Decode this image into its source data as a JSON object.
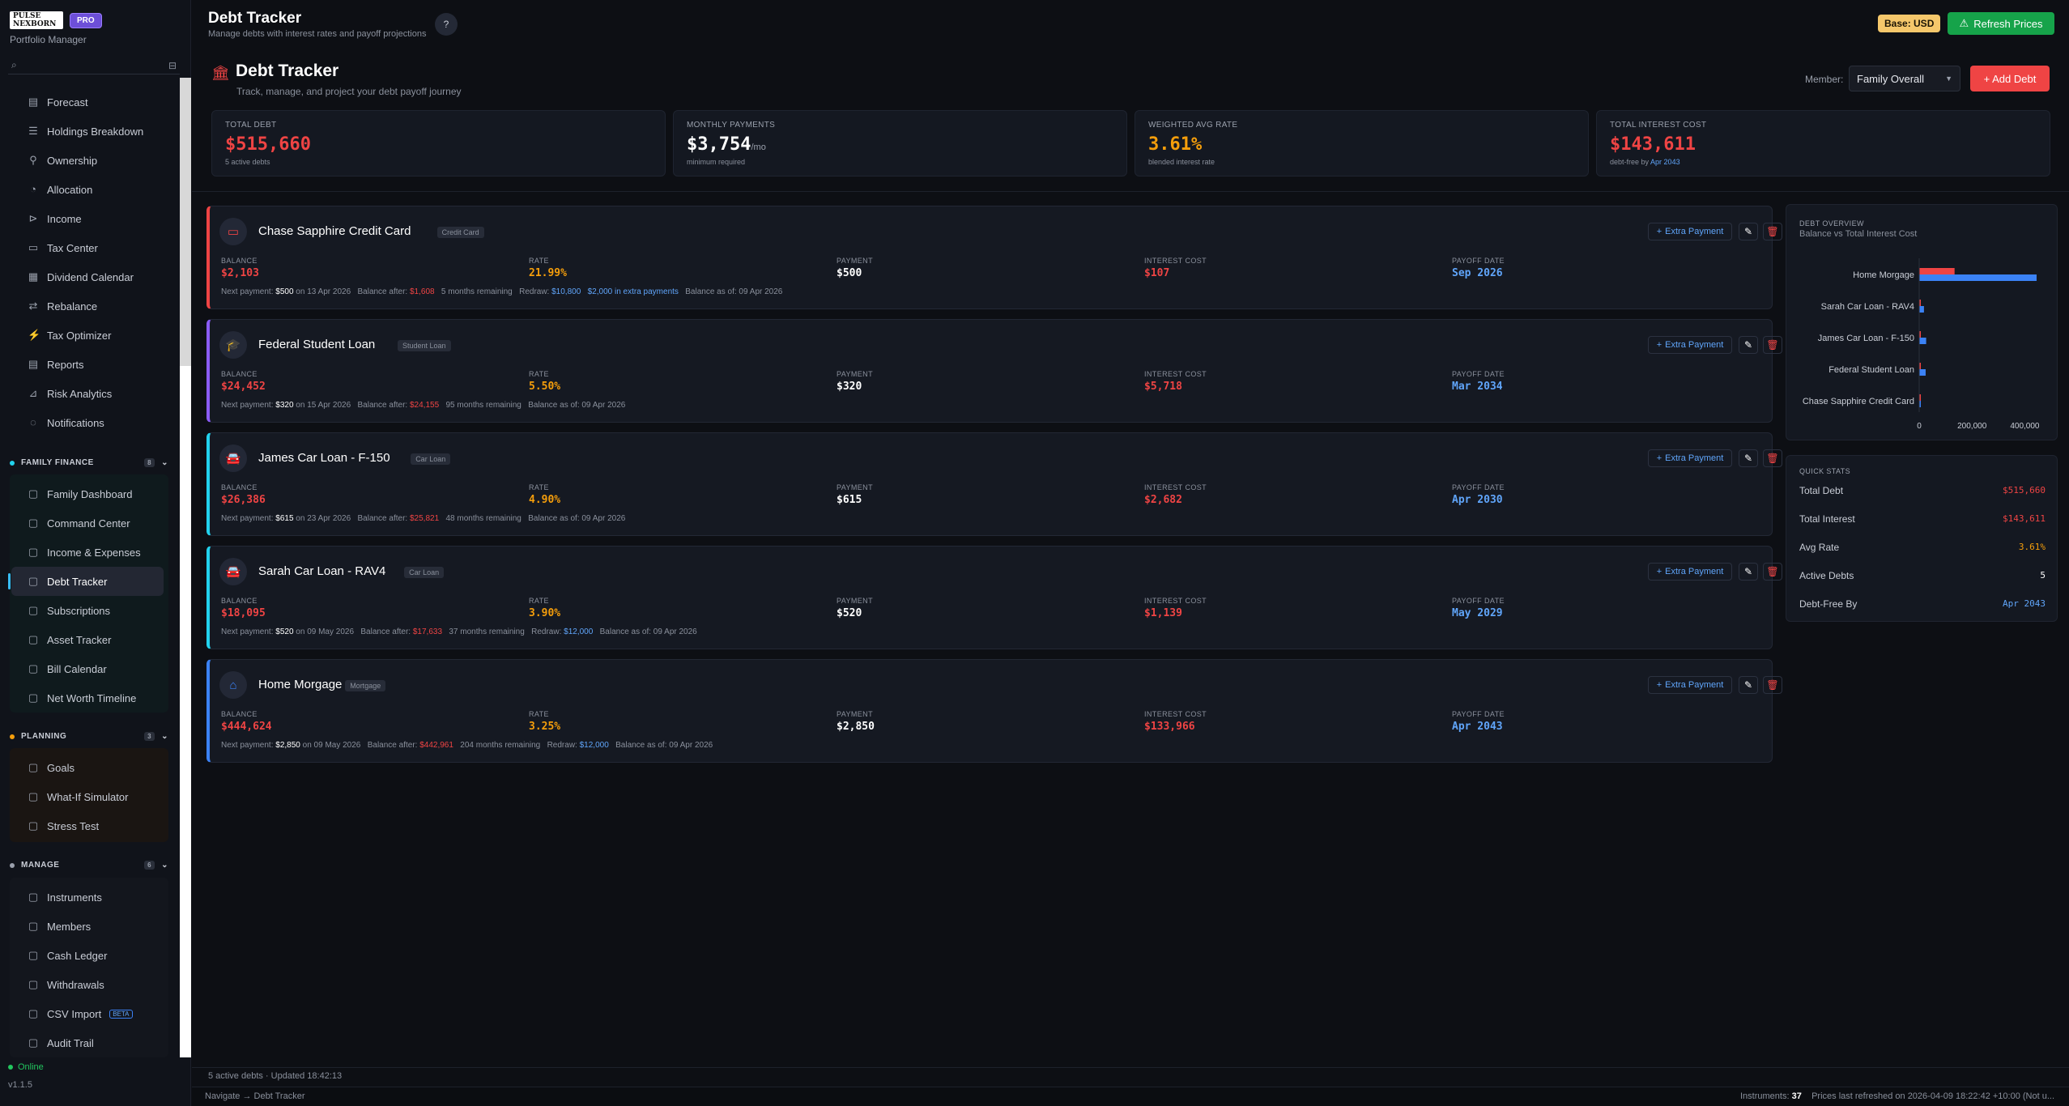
{
  "brand": {
    "logo_text": "PULSE NEXBORN",
    "pro": "PRO",
    "subtitle": "Portfolio Manager"
  },
  "sidebar": {
    "analysis_items": [
      {
        "label": "Forecast",
        "icon": "forecast-icon"
      },
      {
        "label": "Holdings Breakdown",
        "icon": "list-icon"
      },
      {
        "label": "Ownership",
        "icon": "ownership-icon"
      },
      {
        "label": "Allocation",
        "icon": "allocation-icon"
      },
      {
        "label": "Income",
        "icon": "income-icon"
      },
      {
        "label": "Tax Center",
        "icon": "tax-icon"
      },
      {
        "label": "Dividend Calendar",
        "icon": "calendar-icon"
      },
      {
        "label": "Rebalance",
        "icon": "rebalance-icon"
      },
      {
        "label": "Tax Optimizer",
        "icon": "optimizer-icon"
      },
      {
        "label": "Reports",
        "icon": "reports-icon"
      },
      {
        "label": "Risk Analytics",
        "icon": "risk-icon"
      },
      {
        "label": "Notifications",
        "icon": "bell-icon"
      }
    ],
    "family": {
      "title": "FAMILY FINANCE",
      "count": "8",
      "items": [
        {
          "label": "Family Dashboard"
        },
        {
          "label": "Command Center"
        },
        {
          "label": "Income & Expenses"
        },
        {
          "label": "Debt Tracker"
        },
        {
          "label": "Subscriptions"
        },
        {
          "label": "Asset Tracker"
        },
        {
          "label": "Bill Calendar"
        },
        {
          "label": "Net Worth Timeline"
        }
      ]
    },
    "planning": {
      "title": "PLANNING",
      "count": "3",
      "items": [
        {
          "label": "Goals"
        },
        {
          "label": "What-If Simulator"
        },
        {
          "label": "Stress Test"
        }
      ]
    },
    "manage": {
      "title": "MANAGE",
      "count": "6",
      "items": [
        {
          "label": "Instruments"
        },
        {
          "label": "Members"
        },
        {
          "label": "Cash Ledger"
        },
        {
          "label": "Withdrawals"
        },
        {
          "label": "CSV Import",
          "badge": "BETA"
        },
        {
          "label": "Audit Trail"
        }
      ]
    },
    "status": "Online",
    "version": "v1.1.5"
  },
  "topbar": {
    "title": "Debt Tracker",
    "subtitle": "Manage debts with interest rates and payoff projections",
    "help": "?",
    "base": "Base: USD",
    "refresh": "Refresh Prices"
  },
  "page": {
    "title": "Debt Tracker",
    "subtitle": "Track, manage, and project your debt payoff journey",
    "member_label": "Member:",
    "member_value": "Family Overall",
    "add_debt": "+ Add Debt"
  },
  "stats": [
    {
      "label": "TOTAL DEBT",
      "value": "$515,660",
      "unit": "",
      "note": "5 active debts",
      "note_link": "",
      "color": "#ef4444"
    },
    {
      "label": "MONTHLY PAYMENTS",
      "value": "$3,754",
      "unit": "/mo",
      "note": "minimum required",
      "note_link": "",
      "color": "#ffffff"
    },
    {
      "label": "WEIGHTED AVG RATE",
      "value": "3.61%",
      "unit": "",
      "note": "blended interest rate",
      "note_link": "",
      "color": "#f59e0b"
    },
    {
      "label": "TOTAL INTEREST COST",
      "value": "$143,611",
      "unit": "",
      "note": "debt-free by",
      "note_link": "Apr 2043",
      "color": "#ef4444"
    }
  ],
  "labels": {
    "balance": "BALANCE",
    "rate": "RATE",
    "payment": "PAYMENT",
    "interest": "INTEREST COST",
    "payoff": "PAYOFF DATE",
    "extra": "Extra Payment",
    "next_payment": "Next payment:",
    "on": "on",
    "balance_after": "Balance after:",
    "redraw": "Redraw:",
    "balance_as_of": "Balance as of:"
  },
  "debts": [
    {
      "name": "Chase Sapphire Credit Card",
      "type": "Credit Card",
      "balance": "$2,103",
      "rate": "21.99%",
      "payment": "$500",
      "interest": "$107",
      "payoff": "Sep 2026",
      "next_amount": "$500",
      "next_date": "13 Apr 2026",
      "bal_after": "$1,608",
      "remaining": "5 months remaining",
      "redraw": "$10,800",
      "extra_note": "$2,000 in extra payments",
      "as_of": "09 Apr 2026",
      "color": "#ef4444",
      "icon": "credit-card-icon"
    },
    {
      "name": "Federal Student Loan",
      "type": "Student Loan",
      "balance": "$24,452",
      "rate": "5.50%",
      "payment": "$320",
      "interest": "$5,718",
      "payoff": "Mar 2034",
      "next_amount": "$320",
      "next_date": "15 Apr 2026",
      "bal_after": "$24,155",
      "remaining": "95 months remaining",
      "redraw": "",
      "extra_note": "",
      "as_of": "09 Apr 2026",
      "color": "#8b5cf6",
      "icon": "graduation-cap-icon"
    },
    {
      "name": "James Car Loan - F-150",
      "type": "Car Loan",
      "balance": "$26,386",
      "rate": "4.90%",
      "payment": "$615",
      "interest": "$2,682",
      "payoff": "Apr 2030",
      "next_amount": "$615",
      "next_date": "23 Apr 2026",
      "bal_after": "$25,821",
      "remaining": "48 months remaining",
      "redraw": "",
      "extra_note": "",
      "as_of": "09 Apr 2026",
      "color": "#22d3ee",
      "icon": "car-icon"
    },
    {
      "name": "Sarah Car Loan - RAV4",
      "type": "Car Loan",
      "balance": "$18,095",
      "rate": "3.90%",
      "payment": "$520",
      "interest": "$1,139",
      "payoff": "May 2029",
      "next_amount": "$520",
      "next_date": "09 May 2026",
      "bal_after": "$17,633",
      "remaining": "37 months remaining",
      "redraw": "$12,000",
      "extra_note": "",
      "as_of": "09 Apr 2026",
      "color": "#22d3ee",
      "icon": "car-icon"
    },
    {
      "name": "Home Morgage",
      "type": "Mortgage",
      "balance": "$444,624",
      "rate": "3.25%",
      "payment": "$2,850",
      "interest": "$133,966",
      "payoff": "Apr 2043",
      "next_amount": "$2,850",
      "next_date": "09 May 2026",
      "bal_after": "$442,961",
      "remaining": "204 months remaining",
      "redraw": "$12,000",
      "extra_note": "",
      "as_of": "09 Apr 2026",
      "color": "#3b82f6",
      "icon": "home-icon"
    }
  ],
  "overview": {
    "title": "DEBT OVERVIEW",
    "subtitle": "Balance vs Total Interest Cost"
  },
  "chart_data": {
    "type": "bar",
    "orientation": "horizontal",
    "title": "DEBT OVERVIEW",
    "subtitle": "Balance vs Total Interest Cost",
    "categories": [
      "Home Morgage",
      "Sarah Car Loan - RAV4",
      "James Car Loan - F-150",
      "Federal Student Loan",
      "Chase Sapphire Credit Card"
    ],
    "series": [
      {
        "values": [
          133966,
          1139,
          2682,
          5718,
          107
        ],
        "color": "#ef4444"
      },
      {
        "values": [
          444624,
          18095,
          26386,
          24452,
          2103
        ],
        "color": "#3b82f6"
      }
    ],
    "xticks": [
      "0",
      "200,000",
      "400,000"
    ],
    "xlim": [
      0,
      460000
    ],
    "grid": false
  },
  "quick_stats": {
    "title": "QUICK STATS",
    "rows": [
      {
        "label": "Total Debt",
        "value": "$515,660",
        "color": "#ef4444"
      },
      {
        "label": "Total Interest",
        "value": "$143,611",
        "color": "#ef4444"
      },
      {
        "label": "Avg Rate",
        "value": "3.61%",
        "color": "#f59e0b"
      },
      {
        "label": "Active Debts",
        "value": "5",
        "color": "#ffffff"
      },
      {
        "label": "Debt-Free By",
        "value": "Apr 2043",
        "color": "#60a5fa"
      }
    ]
  },
  "footer": {
    "updated": "5 active debts · Updated 18:42:13",
    "nav": "Navigate → Debt Tracker",
    "instruments_label": "Instruments:",
    "instruments": "37",
    "refreshed": "Prices last refreshed on 2026-04-09 18:22:42 +10:00 (Not u..."
  }
}
